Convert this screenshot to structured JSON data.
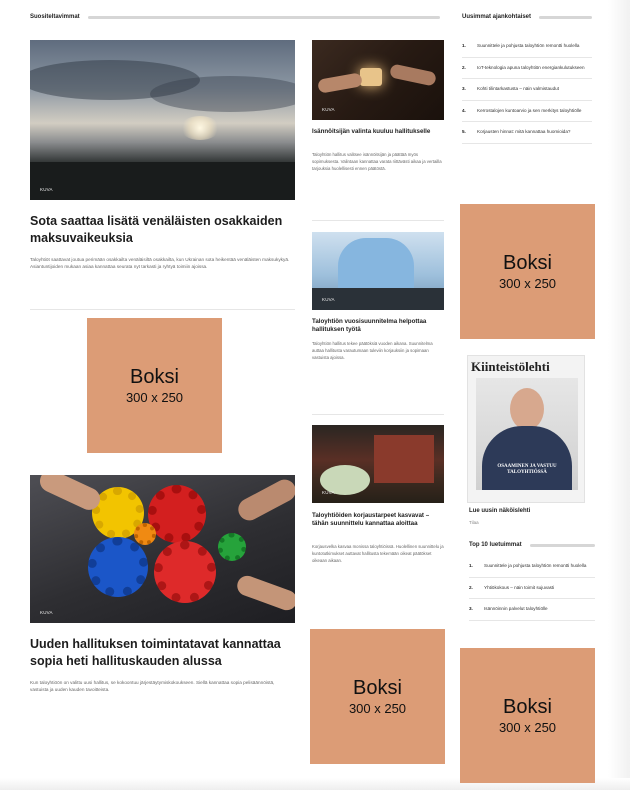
{
  "left_header": {
    "title": "Suositeltavimmat"
  },
  "right_header": {
    "title": "Uusimmat ajankohtaiset"
  },
  "article1": {
    "image_tag": "KUVA",
    "title": "Sota saattaa lisätä venäläisten osakkaiden maksuvaikeuksia",
    "body": "Taloyhtiöt saattavat joutua perimään osakkailta venäläisiltä osakkailta, kun Ukrainan sota heikentää venäläisten maksukykyä. Asiantuntijoiden mukaan asiaa kannattaa seurata nyt tarkasti ja ryhtyä toimiin ajoissa."
  },
  "article2": {
    "image_tag": "KUVA",
    "title": "Uuden hallituksen toimintatavat kannattaa sopia heti hallituskauden alussa",
    "body": "Kun taloyhtiöön on valittu uusi hallitus, se kokoontuu järjestäytymiskokoukseen. Siellä kannattaa sopia pelisäännöistä, vastuista ja uuden kauden tavoitteista."
  },
  "mid_articles": [
    {
      "image_tag": "KUVA",
      "title": "Isännöitsijän valinta kuuluu hallitukselle",
      "body": "Taloyhtiön hallitus valitsee isännöitsijän ja päättää myös sopimuksesta. Valintaan kannattaa varata riittävästi aikaa ja vertailla tarjouksia huolellisesti ennen päätöstä."
    },
    {
      "image_tag": "KUVA",
      "title": "Taloyhtiön vuosisuunnitelma helpottaa hallituksen työtä",
      "body": "Taloyhtiön hallitus tekee päätöksiä vuoden aikana. Suunnitelma auttaa hallitusta varautumaan tuleviin korjauksiin ja sopimaan vastuista ajoissa."
    },
    {
      "image_tag": "KUVA",
      "title": "Taloyhtiöiden korjaustarpeet kasvavat – tähän suunnittelu kannattaa aloittaa",
      "body": "Korjausvelka kasvaa monissa taloyhtiöissä. Huolellinen suunnittelu ja kuntotutkimukset auttavat hallitusta tekemään oikeat päätökset oikeaan aikaan."
    }
  ],
  "top_list": [
    "Suunnittele ja pohjusta taloyhtiön remontti huolella",
    "IoT-teknologia apuna taloyhtiön energiankulutukseen",
    "Kohti tilintarkastusta – näin valmistaudut",
    "Kerrostalojen kuntoarvio ja sen merkitys taloyhtiölle",
    "Korjausten hinnat: mitä kannattaa huomioida?"
  ],
  "ads": [
    {
      "line1": "Boksi",
      "line2": "300 x 250"
    },
    {
      "line1": "Boksi",
      "line2": "300 x 250"
    },
    {
      "line1": "Boksi",
      "line2": "300 x 250"
    },
    {
      "line1": "Boksi",
      "line2": "300 x 250"
    }
  ],
  "magazine": {
    "masthead": "Kiinteistölehti",
    "cover_text": "OSAAMINEN JA VASTUU TALOYHTIÖSSÄ",
    "title": "Lue uusin näköislehti",
    "subtitle": "Tilaa"
  },
  "top10": {
    "title": "Top 10 luetuimmat",
    "items": [
      "Suunnittele ja pohjusta taloyhtiön remontti huolella",
      "Yhtiökokous – näin toimit sujuvasti",
      "Isännöinnin palvelut taloyhtiölle"
    ]
  },
  "colors": {
    "ad": "#dc9c76"
  }
}
